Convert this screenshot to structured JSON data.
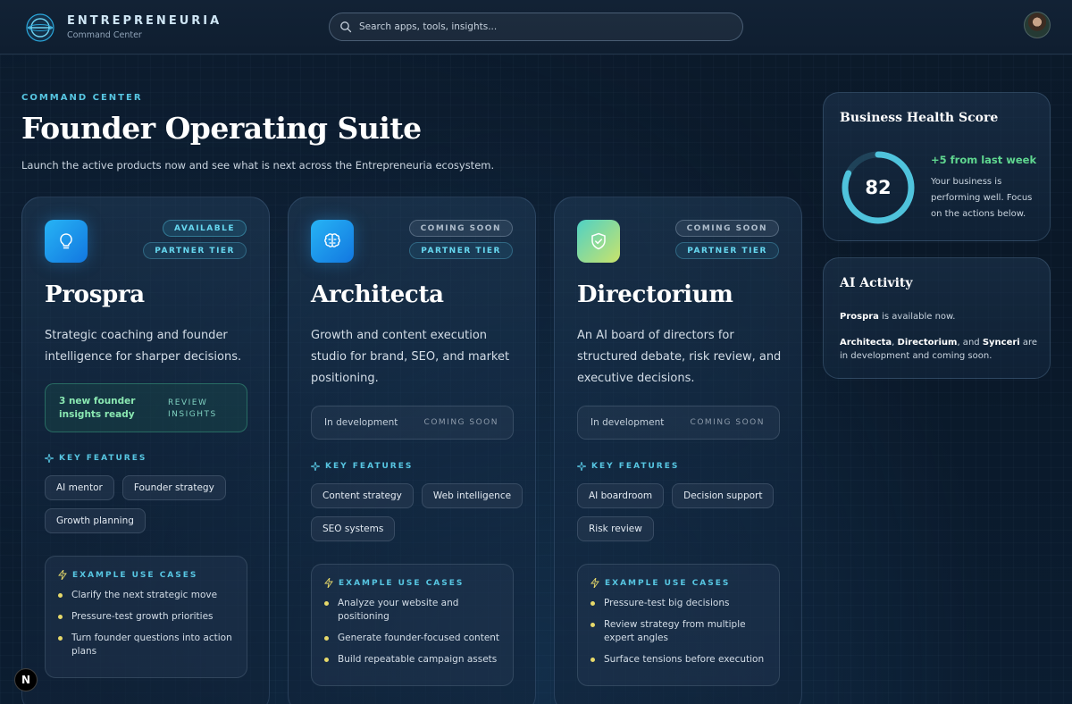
{
  "header": {
    "brand_name": "ENTREPRENEURIA",
    "brand_sub": "Command Center",
    "search_placeholder": "Search apps, tools, insights..."
  },
  "hero": {
    "eyebrow": "COMMAND CENTER",
    "title": "Founder Operating Suite",
    "subtitle": "Launch the active products now and see what is next across the Entrepreneuria ecosystem."
  },
  "cards": [
    {
      "icon": "lightbulb-icon",
      "status_badge": "AVAILABLE",
      "tier_badge": "PARTNER TIER",
      "title": "Prospra",
      "description": "Strategic coaching and founder intelligence for sharper decisions.",
      "insight_text": "3 new founder insights ready",
      "insight_action": "REVIEW INSIGHTS",
      "features_label": "KEY FEATURES",
      "features": [
        "AI mentor",
        "Founder strategy",
        "Growth planning"
      ],
      "use_cases_label": "EXAMPLE USE CASES",
      "use_cases": [
        "Clarify the next strategic move",
        "Pressure-test growth priorities",
        "Turn founder questions into action plans"
      ]
    },
    {
      "icon": "brain-icon",
      "status_badge": "COMING SOON",
      "tier_badge": "PARTNER TIER",
      "title": "Architecta",
      "description": "Growth and content execution studio for brand, SEO, and market positioning.",
      "dev_label": "In development",
      "dev_status": "COMING SOON",
      "features_label": "KEY FEATURES",
      "features": [
        "Content strategy",
        "Web intelligence",
        "SEO systems"
      ],
      "use_cases_label": "EXAMPLE USE CASES",
      "use_cases": [
        "Analyze your website and positioning",
        "Generate founder-focused content",
        "Build repeatable campaign assets"
      ]
    },
    {
      "icon": "shield-check-icon",
      "status_badge": "COMING SOON",
      "tier_badge": "PARTNER TIER",
      "title": "Directorium",
      "description": "An AI board of directors for structured debate, risk review, and executive decisions.",
      "dev_label": "In development",
      "dev_status": "COMING SOON",
      "features_label": "KEY FEATURES",
      "features": [
        "AI boardroom",
        "Decision support",
        "Risk review"
      ],
      "use_cases_label": "EXAMPLE USE CASES",
      "use_cases": [
        "Pressure-test big decisions",
        "Review strategy from multiple expert angles",
        "Surface tensions before execution"
      ]
    }
  ],
  "health": {
    "title": "Business Health Score",
    "score": "82",
    "score_fraction": 0.82,
    "delta": "+5 from last week",
    "note": "Your business is performing well. Focus on the actions below."
  },
  "activity": {
    "title": "AI Activity",
    "line1_product": "Prospra",
    "line1_rest": " is available now.",
    "line2_p1": "Architecta",
    "line2_sep1": ", ",
    "line2_p2": "Directorium",
    "line2_sep2": ", and ",
    "line2_p3": "Synceri",
    "line2_rest": " are in development and coming soon."
  },
  "dev_badge": "N",
  "colors": {
    "accent": "#57c6e2",
    "success": "#5fd68f",
    "bullet": "#e7d96a"
  }
}
